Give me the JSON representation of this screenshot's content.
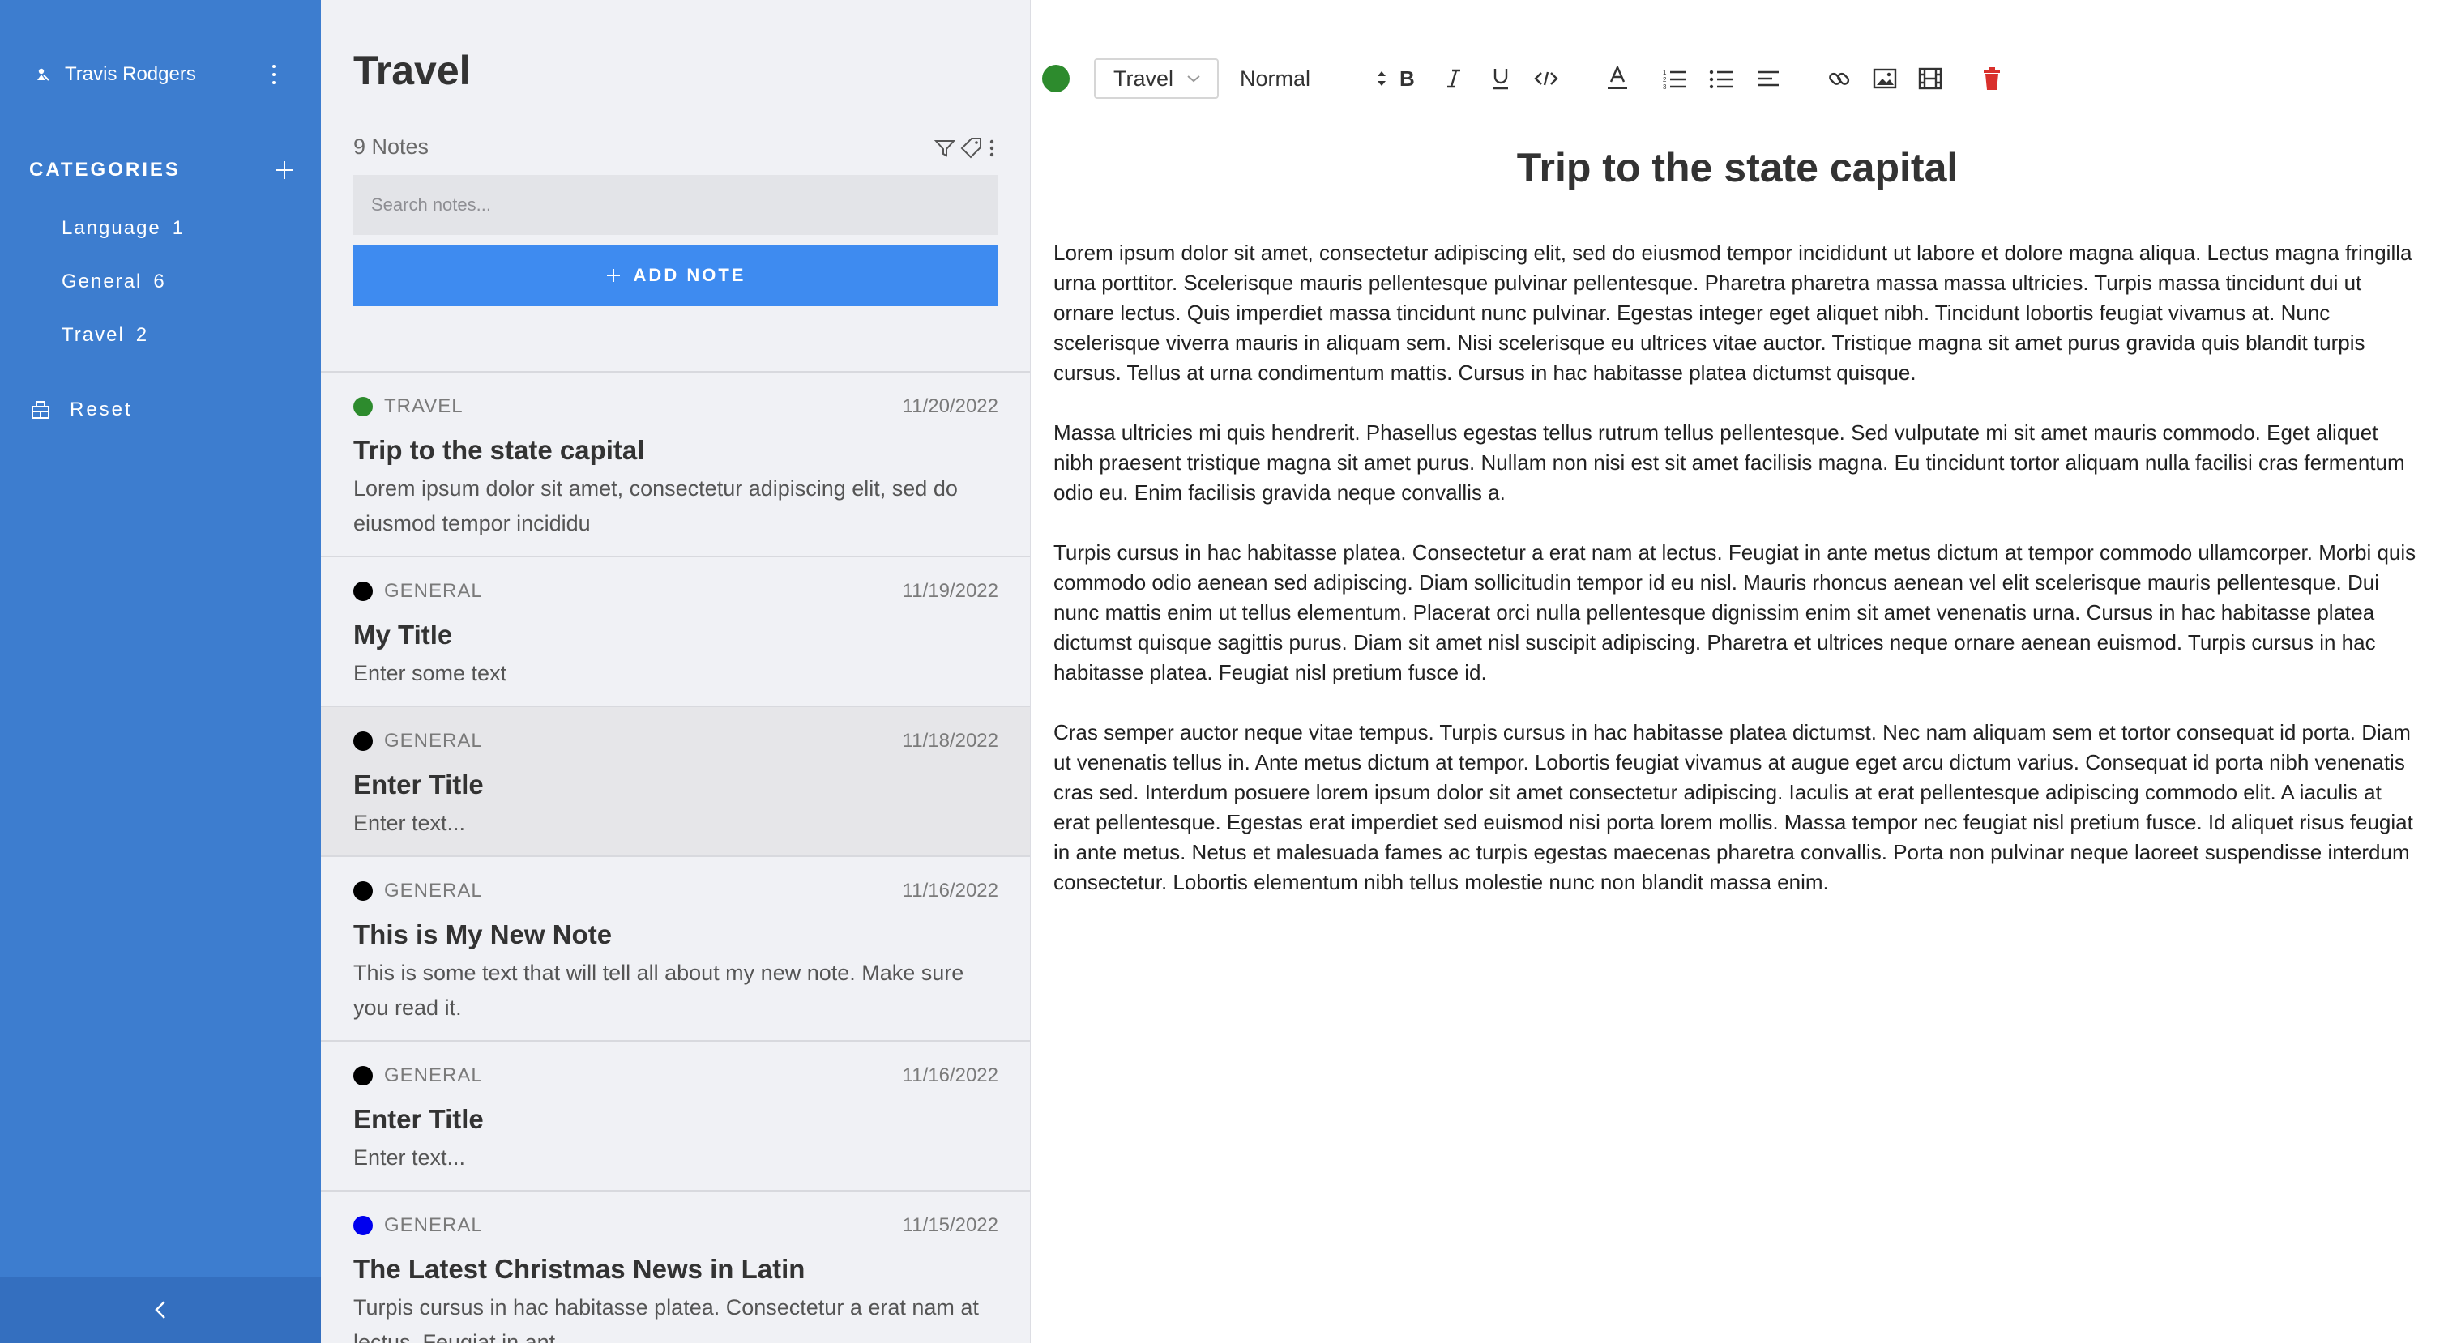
{
  "sidebar": {
    "user_name": "Travis Rodgers",
    "categories_title": "CATEGORIES",
    "categories": [
      {
        "label": "Language",
        "count": "1"
      },
      {
        "label": "General",
        "count": "6"
      },
      {
        "label": "Travel",
        "count": "2"
      }
    ],
    "reset_label": "Reset",
    "bg_color": "#3d7dcf"
  },
  "notes_panel": {
    "title": "Travel",
    "count_label": "9 Notes",
    "search_placeholder": "Search notes...",
    "add_label": "ADD NOTE",
    "accent": "#3e8bf0",
    "notes": [
      {
        "category": "TRAVEL",
        "date": "11/20/2022",
        "title": "Trip to the state capital",
        "excerpt": "Lorem ipsum dolor sit amet, consectetur adipiscing elit, sed do eiusmod tempor incididu",
        "dot_color": "#2d8b2d"
      },
      {
        "category": "GENERAL",
        "date": "11/19/2022",
        "title": "My Title",
        "excerpt": "Enter some text",
        "dot_color": "#000000"
      },
      {
        "category": "GENERAL",
        "date": "11/18/2022",
        "title": "Enter Title",
        "excerpt": "Enter text...",
        "dot_color": "#000000"
      },
      {
        "category": "GENERAL",
        "date": "11/16/2022",
        "title": "This is My New Note",
        "excerpt": "This is some text that will tell all about my new note. Make sure you read it.",
        "dot_color": "#000000"
      },
      {
        "category": "GENERAL",
        "date": "11/16/2022",
        "title": "Enter Title",
        "excerpt": "Enter text...",
        "dot_color": "#000000"
      },
      {
        "category": "GENERAL",
        "date": "11/15/2022",
        "title": "The Latest Christmas News in Latin",
        "excerpt": "Turpis cursus in hac habitasse platea. Consectetur a erat nam at lectus. Feugiat in ant",
        "dot_color": "#0000ee"
      }
    ]
  },
  "editor": {
    "category_select": "Travel",
    "format_select": "Normal",
    "category_color": "#2d8b2d",
    "delete_color": "#d9302c",
    "title": "Trip to the state capital",
    "paragraphs": [
      "Lorem ipsum dolor sit amet, consectetur adipiscing elit, sed do eiusmod tempor incididunt ut labore et dolore magna aliqua. Lectus magna fringilla urna porttitor. Scelerisque mauris pellentesque pulvinar pellentesque. Pharetra pharetra massa massa ultricies. Turpis massa tincidunt dui ut ornare lectus. Quis imperdiet massa tincidunt nunc pulvinar. Egestas integer eget aliquet nibh. Tincidunt lobortis feugiat vivamus at. Nunc scelerisque viverra mauris in aliquam sem. Nisi scelerisque eu ultrices vitae auctor. Tristique magna sit amet purus gravida quis blandit turpis cursus. Tellus at urna condimentum mattis. Cursus in hac habitasse platea dictumst quisque.",
      "Massa ultricies mi quis hendrerit. Phasellus egestas tellus rutrum tellus pellentesque. Sed vulputate mi sit amet mauris commodo. Eget aliquet nibh praesent tristique magna sit amet purus. Nullam non nisi est sit amet facilisis magna. Eu tincidunt tortor aliquam nulla facilisi cras fermentum odio eu. Enim facilisis gravida neque convallis a.",
      "Turpis cursus in hac habitasse platea. Consectetur a erat nam at lectus. Feugiat in ante metus dictum at tempor commodo ullamcorper. Morbi quis commodo odio aenean sed adipiscing. Diam sollicitudin tempor id eu nisl. Mauris rhoncus aenean vel elit scelerisque mauris pellentesque. Dui nunc mattis enim ut tellus elementum. Placerat orci nulla pellentesque dignissim enim sit amet venenatis urna. Cursus in hac habitasse platea dictumst quisque sagittis purus. Diam sit amet nisl suscipit adipiscing. Pharetra et ultrices neque ornare aenean euismod. Turpis cursus in hac habitasse platea. Feugiat nisl pretium fusce id.",
      "Cras semper auctor neque vitae tempus. Turpis cursus in hac habitasse platea dictumst. Nec nam aliquam sem et tortor consequat id porta. Diam ut venenatis tellus in. Ante metus dictum at tempor. Lobortis feugiat vivamus at augue eget arcu dictum varius. Consequat id porta nibh venenatis cras sed. Interdum posuere lorem ipsum dolor sit amet consectetur adipiscing. Iaculis at erat pellentesque adipiscing commodo elit. A iaculis at erat pellentesque. Egestas erat imperdiet sed euismod nisi porta lorem mollis. Massa tempor nec feugiat nisl pretium fusce. Id aliquet risus feugiat in ante metus. Netus et malesuada fames ac turpis egestas maecenas pharetra convallis. Porta non pulvinar neque laoreet suspendisse interdum consectetur. Lobortis elementum nibh tellus molestie nunc non blandit massa enim."
    ]
  }
}
